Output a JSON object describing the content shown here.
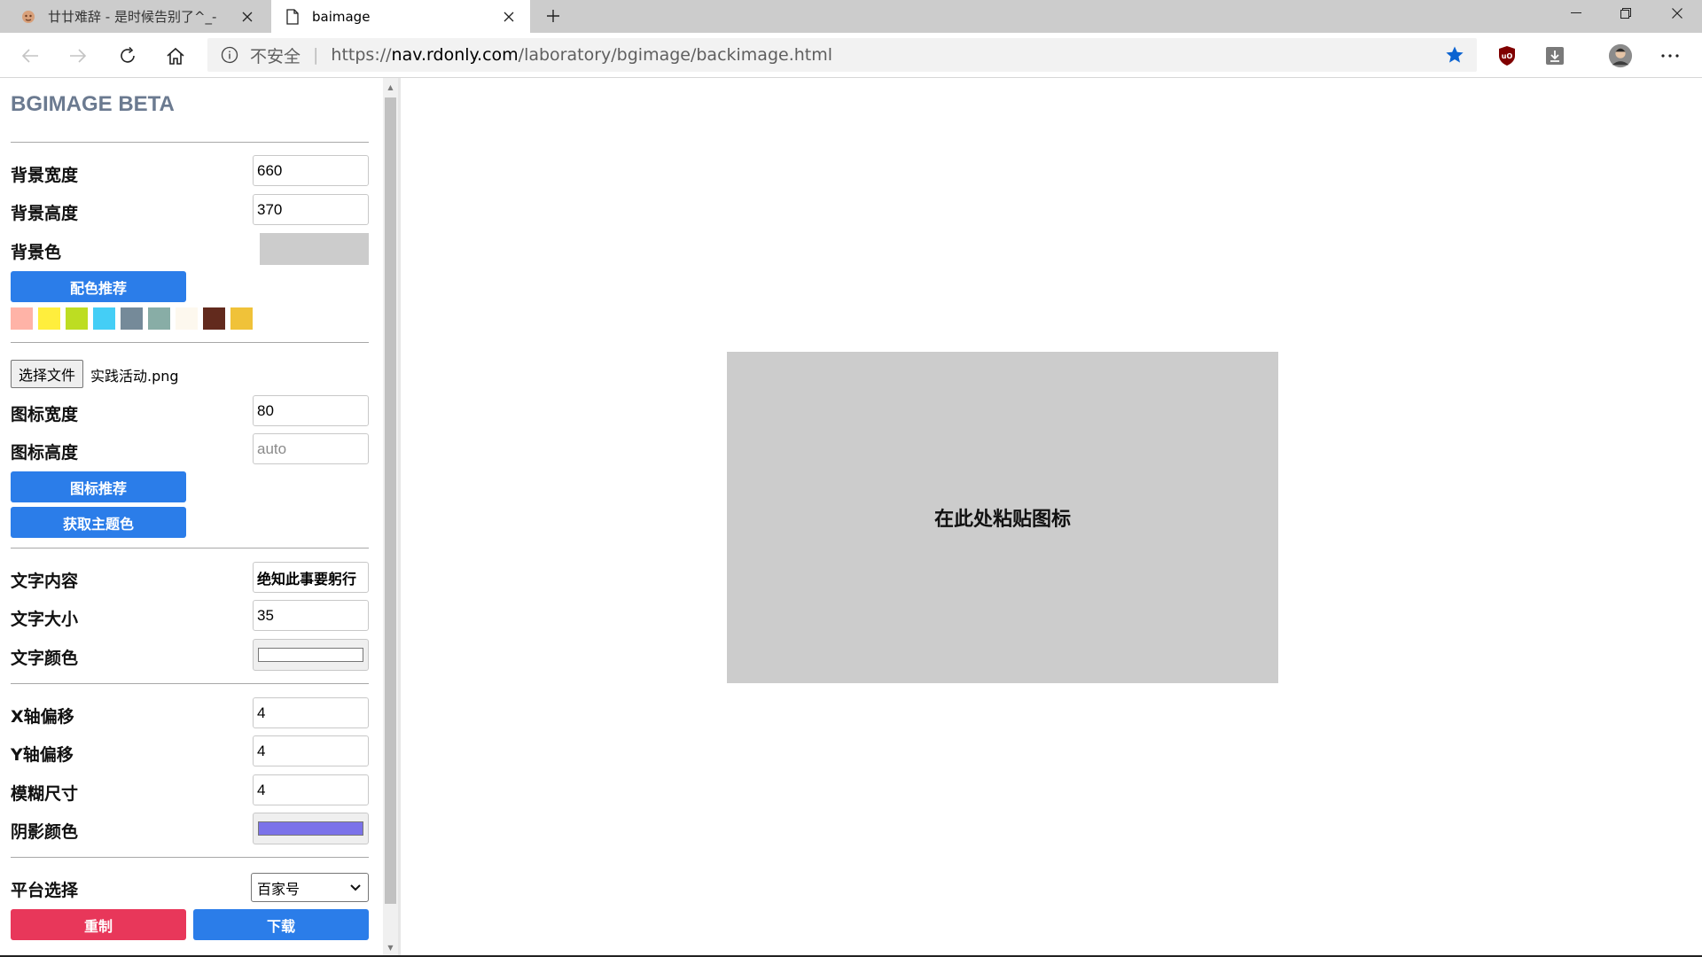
{
  "browser": {
    "tabs": [
      {
        "title": "廿廿难辞 - 是时候告别了^_-",
        "active": false,
        "icon": "emoji-favicon-icon"
      },
      {
        "title": "baimage",
        "active": true,
        "icon": "page-icon"
      }
    ],
    "address": {
      "security_label": "不安全",
      "scheme": "https://",
      "host": "nav.rdonly.com",
      "path": "/laboratory/bgimage/backimage.html"
    }
  },
  "panel": {
    "title": "BGIMAGE BETA",
    "bg_width_label": "背景宽度",
    "bg_width_value": "660",
    "bg_height_label": "背景高度",
    "bg_height_value": "370",
    "bg_color_label": "背景色",
    "bg_color": "#cccccc",
    "color_recommend_button": "配色推荐",
    "swatches": [
      "#ffb3a7",
      "#ffee3d",
      "#bddd22",
      "#44cef6",
      "#758a99",
      "#88ada6",
      "#fdf8ee",
      "#622a1d",
      "#f0c239"
    ],
    "file_button": "选择文件",
    "file_name": "实践活动.png",
    "icon_width_label": "图标宽度",
    "icon_width_value": "80",
    "icon_height_label": "图标高度",
    "icon_height_placeholder": "auto",
    "icon_recommend_button": "图标推荐",
    "theme_color_button": "获取主题色",
    "text_content_label": "文字内容",
    "text_content_value": "绝知此事要躬行",
    "text_size_label": "文字大小",
    "text_size_value": "35",
    "text_color_label": "文字颜色",
    "text_color": "#ffffff",
    "x_offset_label": "X轴偏移",
    "x_offset_value": "4",
    "y_offset_label": "Y轴偏移",
    "y_offset_value": "4",
    "blur_label": "模糊尺寸",
    "blur_value": "4",
    "shadow_color_label": "阴影颜色",
    "shadow_color": "#7b72e9",
    "platform_label": "平台选择",
    "platform_value": "百家号",
    "reset_button": "重制",
    "download_button": "下载"
  },
  "canvas": {
    "paste_hint": "在此处粘贴图标",
    "background": "#cccccc"
  }
}
